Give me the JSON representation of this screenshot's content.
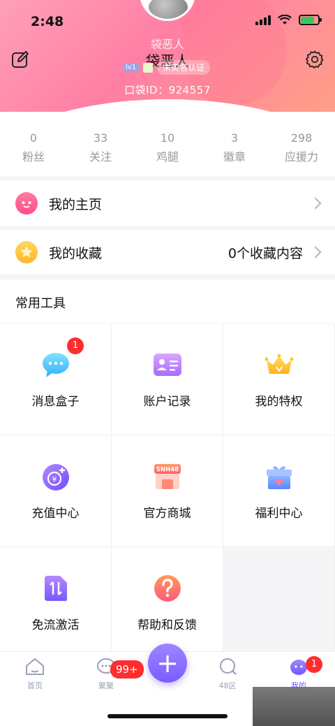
{
  "status": {
    "time": "2:48"
  },
  "profile": {
    "name_shadow": "袋恶人",
    "name": "袋恶人",
    "level": "lv1",
    "verify": "未实名认证",
    "uid": "口袋ID：924557"
  },
  "stats": [
    {
      "value": "0",
      "label": "粉丝"
    },
    {
      "value": "33",
      "label": "关注"
    },
    {
      "value": "10",
      "label": "鸡腿"
    },
    {
      "value": "3",
      "label": "徽章"
    },
    {
      "value": "298",
      "label": "应援力"
    }
  ],
  "rows": {
    "home": {
      "label": "我的主页"
    },
    "favorites": {
      "label": "我的收藏",
      "detail": "0个收藏内容"
    }
  },
  "tools": {
    "title": "常用工具",
    "items": [
      {
        "label": "消息盒子",
        "badge": "1",
        "icon": "message-icon"
      },
      {
        "label": "账户记录",
        "icon": "id-card-icon"
      },
      {
        "label": "我的特权",
        "icon": "crown-icon"
      },
      {
        "label": "充值中心",
        "icon": "coin-plus-icon"
      },
      {
        "label": "官方商城",
        "icon": "shop-icon",
        "shop_text": "SNH48"
      },
      {
        "label": "福利中心",
        "icon": "gift-icon"
      },
      {
        "label": "免流激活",
        "icon": "data-arrows-icon"
      },
      {
        "label": "帮助和反馈",
        "icon": "question-icon"
      }
    ]
  },
  "tabbar": {
    "home": "首页",
    "chat": "聚聚",
    "chat_badge": "99+",
    "zone": "48区",
    "mine": "我的",
    "mine_badge": "1",
    "plus": "+"
  },
  "colors": {
    "accent": "#7b5cff",
    "header_pink": "#ff7fa4",
    "badge_red": "#ff2d2d"
  }
}
